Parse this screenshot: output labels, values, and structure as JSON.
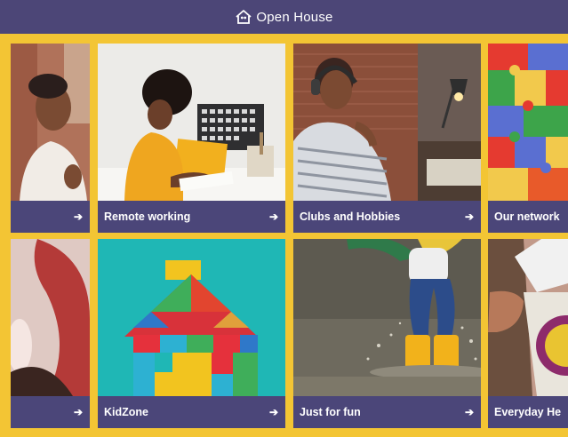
{
  "header": {
    "title": "Open House",
    "icon": "house-speech-icon"
  },
  "colors": {
    "header_bg": "#4c4677",
    "tile_bar": "#4b4679",
    "frame_yellow": "#f3c534"
  },
  "tiles_row1": [
    {
      "label": "",
      "icon": "arrow-right-icon"
    },
    {
      "label": "Remote working",
      "icon": "arrow-right-icon"
    },
    {
      "label": "Clubs and Hobbies",
      "icon": "arrow-right-icon"
    },
    {
      "label": "Our network",
      "icon": "arrow-right-icon"
    }
  ],
  "tiles_row2": [
    {
      "label": "",
      "icon": "arrow-right-icon"
    },
    {
      "label": "KidZone",
      "icon": "arrow-right-icon"
    },
    {
      "label": "Just for fun",
      "icon": "arrow-right-icon"
    },
    {
      "label": "Everyday Her",
      "icon": "arrow-right-icon"
    }
  ],
  "arrow_glyph": "➔"
}
